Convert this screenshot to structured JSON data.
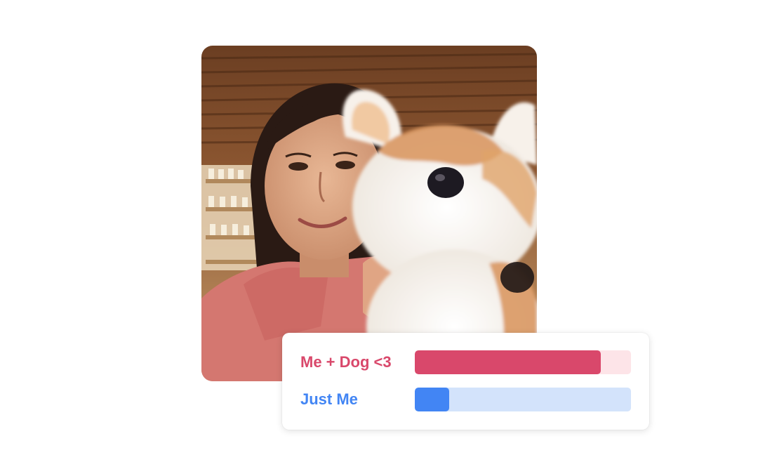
{
  "photo": {
    "subject": "selfie of a woman in a pink hoodie holding a plush corgi"
  },
  "poll": {
    "options": [
      {
        "label": "Me + Dog <3",
        "share": 0.86,
        "color": "#d9486b",
        "track_color": "#fde4e8"
      },
      {
        "label": "Just Me",
        "share": 0.16,
        "color": "#4285f4",
        "track_color": "#d3e3fb"
      }
    ]
  }
}
